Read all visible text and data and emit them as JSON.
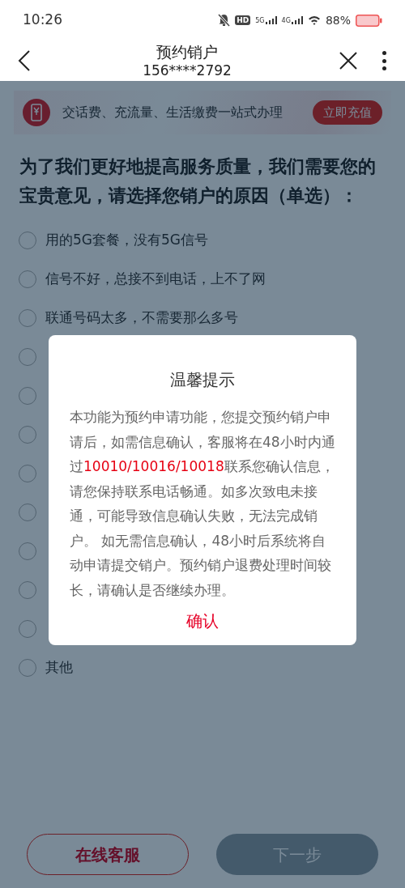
{
  "status_bar": {
    "time": "10:26",
    "hd": "HD",
    "sim1": "5G",
    "sim2": "4G",
    "battery": "88%"
  },
  "header": {
    "title": "预约销户",
    "subtitle": "156****2792"
  },
  "banner": {
    "text": "交话费、充流量、生活缴费一站式办理",
    "button": "立即充值"
  },
  "question": "为了我们更好地提高服务质量，我们需要您的宝贵意见，请选择您销户的原因（单选）：",
  "options": [
    {
      "label": "用的5G套餐，没有5G信号",
      "selected": false
    },
    {
      "label": "信号不好，总接不到电话，上不了网",
      "selected": false
    },
    {
      "label": "联通号码太多，不需要那么多号",
      "selected": false
    },
    {
      "selected": false
    },
    {
      "selected": false
    },
    {
      "selected": false
    },
    {
      "selected": false
    },
    {
      "selected": false
    },
    {
      "selected": false
    },
    {
      "selected": false
    },
    {
      "selected": false
    },
    {
      "label": "其他",
      "selected": false
    }
  ],
  "footer": {
    "service_button": "在线客服",
    "next_button": {
      "label": "下一步",
      "disabled": true
    }
  },
  "dialog": {
    "title": "温馨提示",
    "message": {
      "before": "本功能为预约申请功能，您提交预约销户申请后，如需信息确认，客服将在48小时内通过",
      "highlight": "10010/10016/10018",
      "after": "联系您确认信息，请您保持联系电话畅通。如多次致电未接通，可能导致信息确认失败，无法完成销户。 如无需信息确认，48小时后系统将自动申请提交销户。预约销户退费处理时间较长，请确认是否继续办理。"
    },
    "confirm": "确认"
  }
}
